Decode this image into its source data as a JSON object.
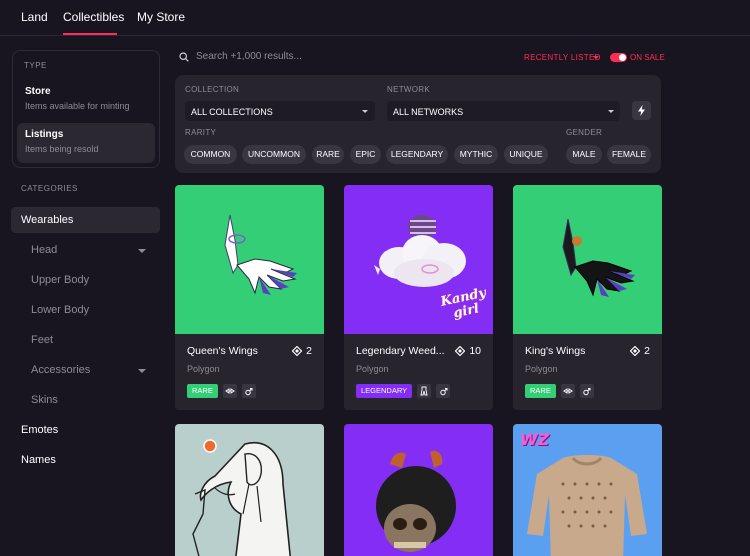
{
  "nav": {
    "tabs": [
      {
        "label": "Land"
      },
      {
        "label": "Collectibles"
      },
      {
        "label": "My Store"
      }
    ]
  },
  "sidebar": {
    "type_title": "TYPE",
    "types": [
      {
        "title": "Store",
        "subtitle": "Items available for minting"
      },
      {
        "title": "Listings",
        "subtitle": "Items being resold"
      }
    ],
    "categories_title": "CATEGORIES",
    "categories": [
      {
        "label": "Wearables"
      },
      {
        "label": "Head"
      },
      {
        "label": "Upper Body"
      },
      {
        "label": "Lower Body"
      },
      {
        "label": "Feet"
      },
      {
        "label": "Accessories"
      },
      {
        "label": "Skins"
      },
      {
        "label": "Emotes"
      },
      {
        "label": "Names"
      }
    ]
  },
  "search": {
    "placeholder": "Search +1,000 results..."
  },
  "sort": {
    "label": "RECENTLY LISTED"
  },
  "on_sale": {
    "label": "ON SALE"
  },
  "filters": {
    "collection_label": "COLLECTION",
    "collection_value": "ALL COLLECTIONS",
    "network_label": "NETWORK",
    "network_value": "ALL NETWORKS",
    "rarity_label": "RARITY",
    "rarities": [
      "COMMON",
      "UNCOMMON",
      "RARE",
      "EPIC",
      "LEGENDARY",
      "MYTHIC",
      "UNIQUE"
    ],
    "gender_label": "GENDER",
    "genders": [
      "MALE",
      "FEMALE"
    ]
  },
  "cards": [
    {
      "name": "Queen's Wings",
      "price": "2",
      "network": "Polygon",
      "rarity": "RARE",
      "rarity_color": "#34ce76",
      "bg": "#34ce76"
    },
    {
      "name": "Legendary Weed...",
      "price": "10",
      "network": "Polygon",
      "rarity": "LEGENDARY",
      "rarity_color": "#842df4",
      "bg": "#842df4",
      "image_text": "Kandy girl"
    },
    {
      "name": "King's Wings",
      "price": "2",
      "network": "Polygon",
      "rarity": "RARE",
      "rarity_color": "#34ce76",
      "bg": "#34ce76"
    }
  ],
  "cards_row2": [
    {
      "bg": "#b9cfcb"
    },
    {
      "bg": "#842df4"
    },
    {
      "bg": "#5ba0f0",
      "image_text": "WZ"
    }
  ],
  "icons": {
    "search": "search-icon",
    "diamond": "mana-icon",
    "bolt": "lightning-icon",
    "gender": "unisex-icon",
    "category": "wearable-icon"
  }
}
